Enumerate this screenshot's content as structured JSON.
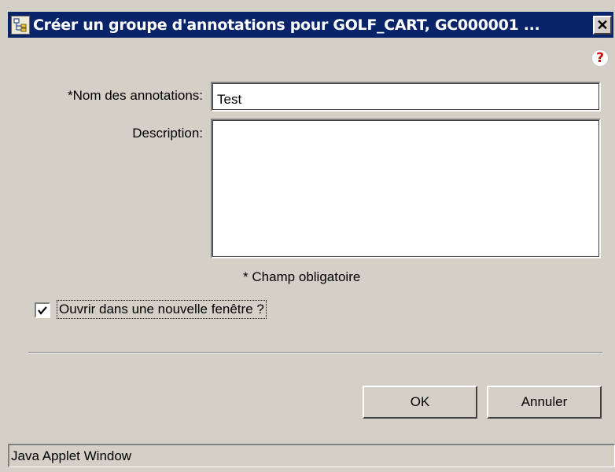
{
  "window": {
    "title": "Créer un groupe d'annotations pour GOLF_CART, GC000001 ...",
    "close_symbol": "✕",
    "title_color": "#0a246a",
    "app_icon": "annotation-group-icon"
  },
  "help": {
    "symbol": "?",
    "icon": "help-icon",
    "color": "#d40000"
  },
  "form": {
    "name_label": "*Nom des annotations:",
    "name_value": "Test",
    "description_label": "Description:",
    "description_value": "",
    "required_note": "* Champ obligatoire",
    "open_new_window_label": "Ouvrir dans une nouvelle fenêtre ?",
    "open_new_window_checked": true
  },
  "buttons": {
    "ok": "OK",
    "cancel": "Annuler"
  },
  "status_bar": {
    "text": "Java Applet Window"
  }
}
